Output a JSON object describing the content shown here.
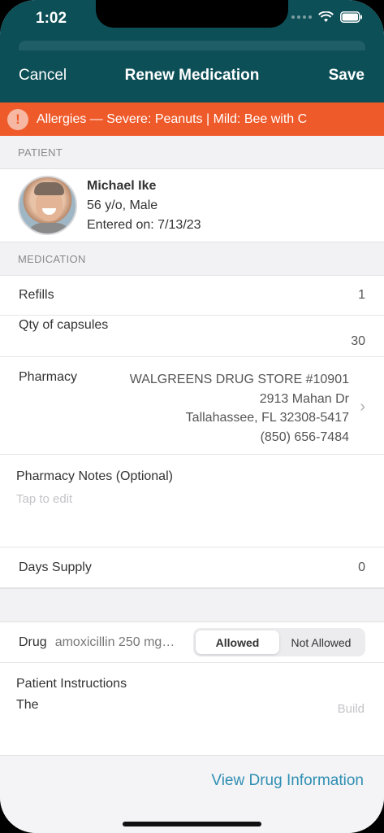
{
  "status_bar": {
    "time": "1:02"
  },
  "nav": {
    "cancel": "Cancel",
    "title": "Renew Medication",
    "save": "Save"
  },
  "allergy_banner": {
    "icon": "!",
    "text": "Allergies — Severe: Peanuts | Mild: Bee with C"
  },
  "patient_section": {
    "header": "PATIENT",
    "name": "Michael Ike",
    "age_sex": "56 y/o, Male",
    "entered": "Entered on: 7/13/23"
  },
  "medication_section": {
    "header": "MEDICATION",
    "refills_label": "Refills",
    "refills_value": "1",
    "qty_label": "Qty of capsules",
    "qty_value": "30",
    "pharmacy_label": "Pharmacy",
    "pharmacy_lines": [
      "WALGREENS DRUG STORE #10901",
      "2913 Mahan Dr",
      "Tallahassee, FL 32308-5417",
      "(850) 656-7484"
    ],
    "notes_label": "Pharmacy Notes (Optional)",
    "notes_placeholder": "Tap to edit",
    "days_label": "Days Supply",
    "days_value": "0"
  },
  "drug_row": {
    "label": "Drug",
    "name": "amoxicillin 250 mg…",
    "options": [
      "Allowed",
      "Not Allowed"
    ],
    "selected": "Allowed"
  },
  "instructions": {
    "label": "Patient Instructions",
    "text": "The",
    "hint": "Build"
  },
  "footer": {
    "link": "View Drug Information"
  },
  "colors": {
    "header": "#0d4f57",
    "alert": "#ef5a2a",
    "link": "#2f8fb3"
  }
}
